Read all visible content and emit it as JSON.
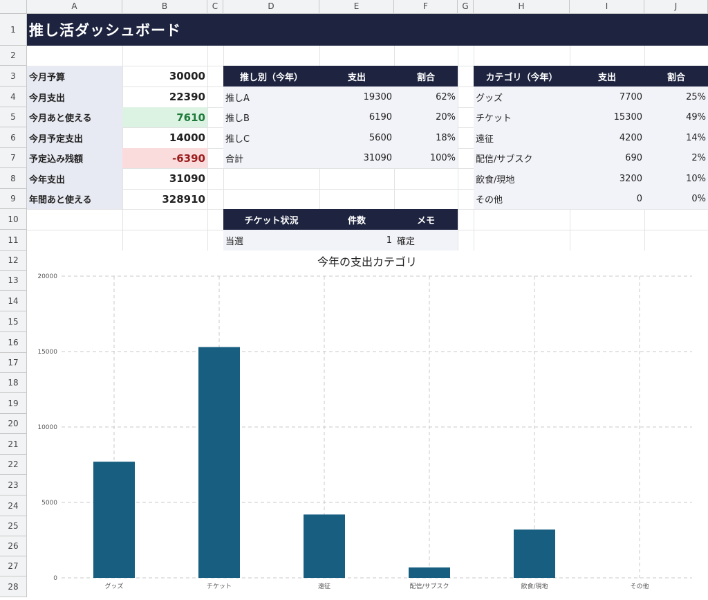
{
  "sheet": {
    "columns": [
      "A",
      "B",
      "C",
      "D",
      "E",
      "F",
      "G",
      "H",
      "I",
      "J"
    ],
    "rows": [
      "1",
      "2",
      "3",
      "4",
      "5",
      "6",
      "7",
      "8",
      "9",
      "10",
      "11",
      "12",
      "13",
      "14",
      "15",
      "16",
      "17",
      "18",
      "19",
      "20",
      "21",
      "22",
      "23",
      "24",
      "25",
      "26",
      "27",
      "28"
    ],
    "title": "推し活ダッシュボード"
  },
  "summary": {
    "items": [
      {
        "label": "今月予算",
        "value": "30000"
      },
      {
        "label": "今月支出",
        "value": "22390"
      },
      {
        "label": "今月あと使える",
        "value": "7610"
      },
      {
        "label": "今月予定支出",
        "value": "14000"
      },
      {
        "label": "予定込み残額",
        "value": "-6390"
      },
      {
        "label": "今年支出",
        "value": "31090"
      },
      {
        "label": "年間あと使える",
        "value": "328910"
      }
    ]
  },
  "oshi_table": {
    "headers": [
      "推し別（今年）",
      "支出",
      "割合"
    ],
    "rows": [
      [
        "推しA",
        "19300",
        "62%"
      ],
      [
        "推しB",
        "6190",
        "20%"
      ],
      [
        "推しC",
        "5600",
        "18%"
      ],
      [
        "合計",
        "31090",
        "100%"
      ]
    ]
  },
  "category_table": {
    "headers": [
      "カテゴリ（今年）",
      "支出",
      "割合"
    ],
    "rows": [
      [
        "グッズ",
        "7700",
        "25%"
      ],
      [
        "チケット",
        "15300",
        "49%"
      ],
      [
        "遠征",
        "4200",
        "14%"
      ],
      [
        "配信/サブスク",
        "690",
        "2%"
      ],
      [
        "飲食/現地",
        "3200",
        "10%"
      ],
      [
        "その他",
        "0",
        "0%"
      ]
    ]
  },
  "ticket_table": {
    "headers": [
      "チケット状況",
      "件数",
      "メモ"
    ],
    "rows": [
      [
        "当選",
        "1",
        "確定"
      ]
    ]
  },
  "chart_data": {
    "type": "bar",
    "title": "今年の支出カテゴリ",
    "categories": [
      "グッズ",
      "チケット",
      "遠征",
      "配信/サブスク",
      "飲食/現地",
      "その他"
    ],
    "values": [
      7700,
      15300,
      4200,
      690,
      3200,
      0
    ],
    "ylim": [
      0,
      20000
    ],
    "yticks": [
      "0",
      "5000",
      "10000",
      "15000",
      "20000"
    ],
    "grid": true,
    "bar_color": "#175e80"
  },
  "colors": {
    "header_dark": "#1e2440",
    "label_bg": "#e8eaf3",
    "positive": "#1e7a3a",
    "negative": "#9b1c1c"
  }
}
